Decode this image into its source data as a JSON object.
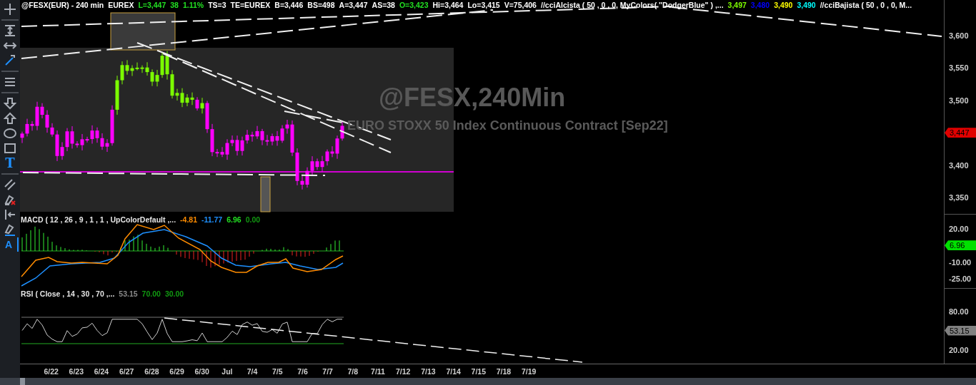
{
  "toolbar": {
    "groups": [
      {
        "tools": [
          {
            "kind": "crosshair",
            "selected": false
          }
        ]
      },
      {
        "tools": [
          {
            "kind": "vertical-resize",
            "selected": false
          },
          {
            "kind": "horizontal-resize",
            "selected": false
          },
          {
            "kind": "pencil",
            "selected": false
          }
        ]
      },
      {
        "tools": [
          {
            "kind": "menu",
            "selected": false
          }
        ]
      },
      {
        "tools": [
          {
            "kind": "arrow-down",
            "selected": false
          },
          {
            "kind": "arrow-up",
            "selected": false
          },
          {
            "kind": "ellipse",
            "selected": false
          },
          {
            "kind": "rectangle",
            "selected": false
          },
          {
            "kind": "text",
            "label": "T",
            "selected": true
          }
        ]
      },
      {
        "tools": [
          {
            "kind": "parallel-lines",
            "selected": false
          },
          {
            "kind": "pen-delete",
            "selected": false
          },
          {
            "kind": "jump-left",
            "selected": false
          },
          {
            "kind": "pen",
            "selected": false
          },
          {
            "kind": "text-cursor",
            "label": "A",
            "selected": false
          }
        ]
      }
    ]
  },
  "info_bar": {
    "segments": [
      {
        "text": "@FESX(EUR) - 240 min",
        "color": "#ffffff"
      },
      {
        "text": "EUREX",
        "color": "#ffffff"
      },
      {
        "text": "L=3,447",
        "color": "#22e022"
      },
      {
        "text": "38",
        "color": "#22e022"
      },
      {
        "text": "1.11%",
        "color": "#22e022"
      },
      {
        "text": "TS=3",
        "color": "#ffffff"
      },
      {
        "text": "TE=EUREX",
        "color": "#ffffff"
      },
      {
        "text": "B=3,446",
        "color": "#ffffff"
      },
      {
        "text": "BS=498",
        "color": "#ffffff"
      },
      {
        "text": "A=3,447",
        "color": "#ffffff"
      },
      {
        "text": "AS=38",
        "color": "#ffffff"
      },
      {
        "text": "O=3,423",
        "color": "#22e022"
      },
      {
        "text": "Hi=3,464",
        "color": "#ffffff"
      },
      {
        "text": "Lo=3,415",
        "color": "#ffffff"
      },
      {
        "text": "V=75,406",
        "color": "#ffffff"
      },
      {
        "text": "//cciAlcista ( 50 , 0 , 0, MyColors( \"DodgerBlue\" ) ,...",
        "color": "#ffffff"
      },
      {
        "text": "3,497",
        "color": "#7fff00"
      },
      {
        "text": "3,480",
        "color": "#0000ff"
      },
      {
        "text": "3,490",
        "color": "#ffff00"
      },
      {
        "text": "3,490",
        "color": "#00ffff"
      },
      {
        "text": "//cciBajista ( 50 , 0 , 0, M...",
        "color": "#ffffff"
      }
    ]
  },
  "price_panel": {
    "watermark": {
      "symbol": "@FESX,240Min",
      "description": "EURO STOXX 50 Index Continuous Contract [Sep22]"
    },
    "axis": [
      {
        "kind": "tick",
        "text": "3,600"
      },
      {
        "kind": "tick",
        "text": "3,550"
      },
      {
        "kind": "tick",
        "text": "3,500"
      },
      {
        "kind": "marker",
        "text": "3,447",
        "color": "#e00000"
      },
      {
        "kind": "tick",
        "text": "3,400"
      },
      {
        "kind": "tick",
        "text": "3,350"
      }
    ]
  },
  "macd_panel": {
    "title": "MACD ( 12 , 26 , 9 , 1 , 1 , UpColorDefault ,...",
    "values": [
      {
        "text": "-4.81",
        "color": "#ff8c00"
      },
      {
        "text": "-11.77",
        "color": "#1e90ff"
      },
      {
        "text": "6.96",
        "color": "#22e022"
      },
      {
        "text": "0.00",
        "color": "#119911"
      }
    ],
    "axis": [
      {
        "kind": "tick",
        "text": "20.00"
      },
      {
        "kind": "marker",
        "text": "6.96",
        "color": "#00e000"
      },
      {
        "kind": "tick",
        "text": "-10.00"
      },
      {
        "kind": "tick",
        "text": "-25.00"
      }
    ]
  },
  "rsi_panel": {
    "title": "RSI ( Close , 14 , 30 , 70 ,...",
    "values": [
      {
        "text": "53.15",
        "color": "#8a8a8a"
      },
      {
        "text": "70.00",
        "color": "#119911"
      },
      {
        "text": "30.00",
        "color": "#119911"
      }
    ],
    "axis": [
      {
        "kind": "tick",
        "text": "80.00"
      },
      {
        "kind": "marker",
        "text": "53.15",
        "color": "#808080"
      },
      {
        "kind": "tick",
        "text": "20.00"
      }
    ]
  },
  "date_axis": {
    "labels": [
      "6/22",
      "6/23",
      "6/24",
      "6/27",
      "6/28",
      "6/29",
      "6/30",
      "Jul",
      "7/4",
      "7/5",
      "7/6",
      "7/7",
      "7/8",
      "7/11",
      "7/12",
      "7/13",
      "7/14",
      "7/15",
      "7/18",
      "7/19"
    ]
  }
}
